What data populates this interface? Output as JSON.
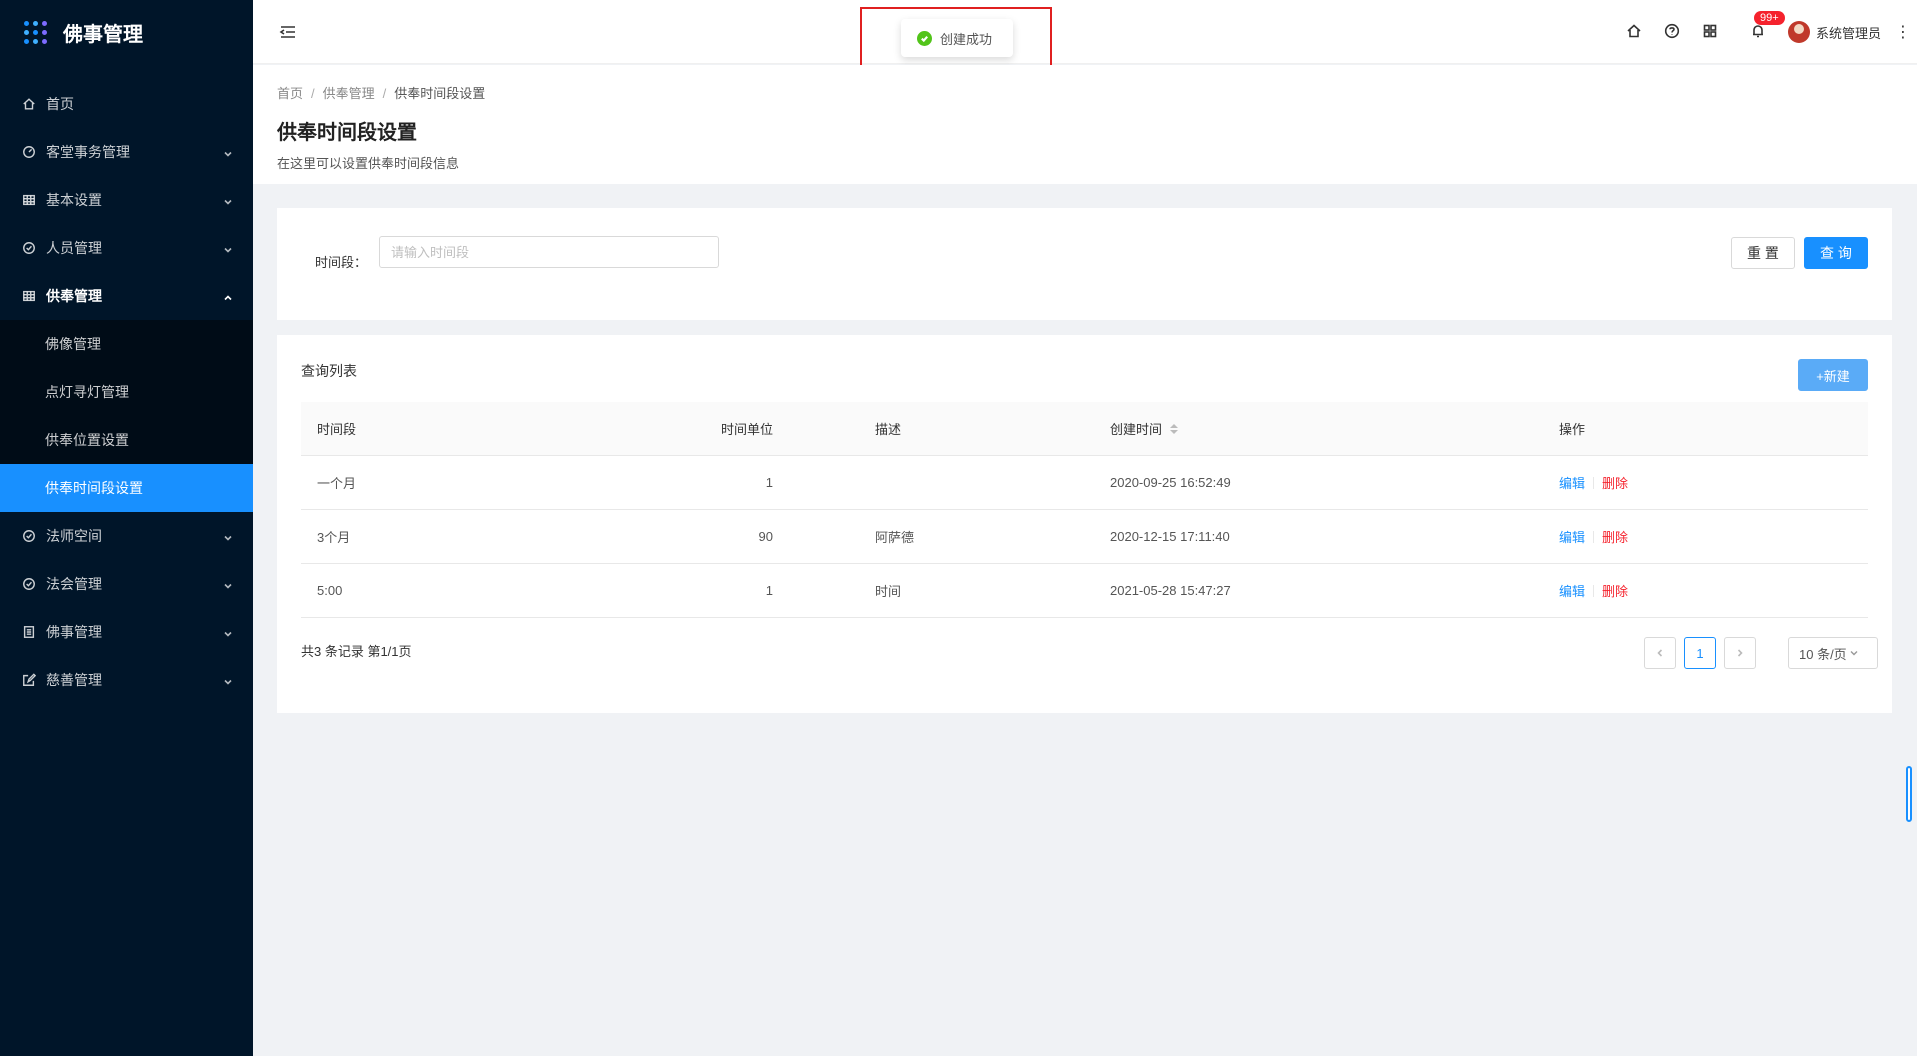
{
  "app": {
    "title": "佛事管理"
  },
  "sidebar": {
    "items": [
      {
        "label": "首页",
        "icon": "home-icon"
      },
      {
        "label": "客堂事务管理",
        "icon": "dashboard-icon"
      },
      {
        "label": "基本设置",
        "icon": "table-icon"
      },
      {
        "label": "人员管理",
        "icon": "check-circle-icon"
      },
      {
        "label": "供奉管理",
        "icon": "table-icon"
      },
      {
        "label": "法师空间",
        "icon": "check-circle-icon"
      },
      {
        "label": "法会管理",
        "icon": "check-circle-icon"
      },
      {
        "label": "佛事管理",
        "icon": "profile-icon"
      },
      {
        "label": "慈善管理",
        "icon": "edit-icon"
      }
    ],
    "submenu": [
      {
        "label": "佛像管理"
      },
      {
        "label": "点灯寻灯管理"
      },
      {
        "label": "供奉位置设置"
      },
      {
        "label": "供奉时间段设置"
      }
    ]
  },
  "header": {
    "notification_count": "99+",
    "user_name": "系统管理员"
  },
  "toast": {
    "message": "创建成功"
  },
  "breadcrumb": [
    "首页",
    "供奉管理",
    "供奉时间段设置"
  ],
  "page": {
    "title": "供奉时间段设置",
    "description": "在这里可以设置供奉时间段信息"
  },
  "search": {
    "label": "时间段：",
    "placeholder": "请输入时间段",
    "value": "",
    "reset_label": "重 置",
    "query_label": "查 询"
  },
  "table": {
    "title": "查询列表",
    "new_label": "+新建",
    "columns": [
      "时间段",
      "时间单位",
      "描述",
      "创建时间",
      "操作"
    ],
    "rows": [
      {
        "period": "一个月",
        "unit": "1",
        "desc": "",
        "created": "2020-09-25 16:52:49"
      },
      {
        "period": "3个月",
        "unit": "90",
        "desc": "阿萨德",
        "created": "2020-12-15 17:11:40"
      },
      {
        "period": "5:00",
        "unit": "1",
        "desc": "时间",
        "created": "2021-05-28 15:47:27"
      }
    ],
    "edit_label": "编辑",
    "delete_label": "删除"
  },
  "pagination": {
    "summary": "共3 条记录 第1/1页",
    "current_page": "1",
    "page_size": "10 条/页"
  },
  "colors": {
    "primary": "#1890ff",
    "sidebar_bg": "#001529",
    "danger": "#f5222d",
    "success": "#52c41a"
  }
}
